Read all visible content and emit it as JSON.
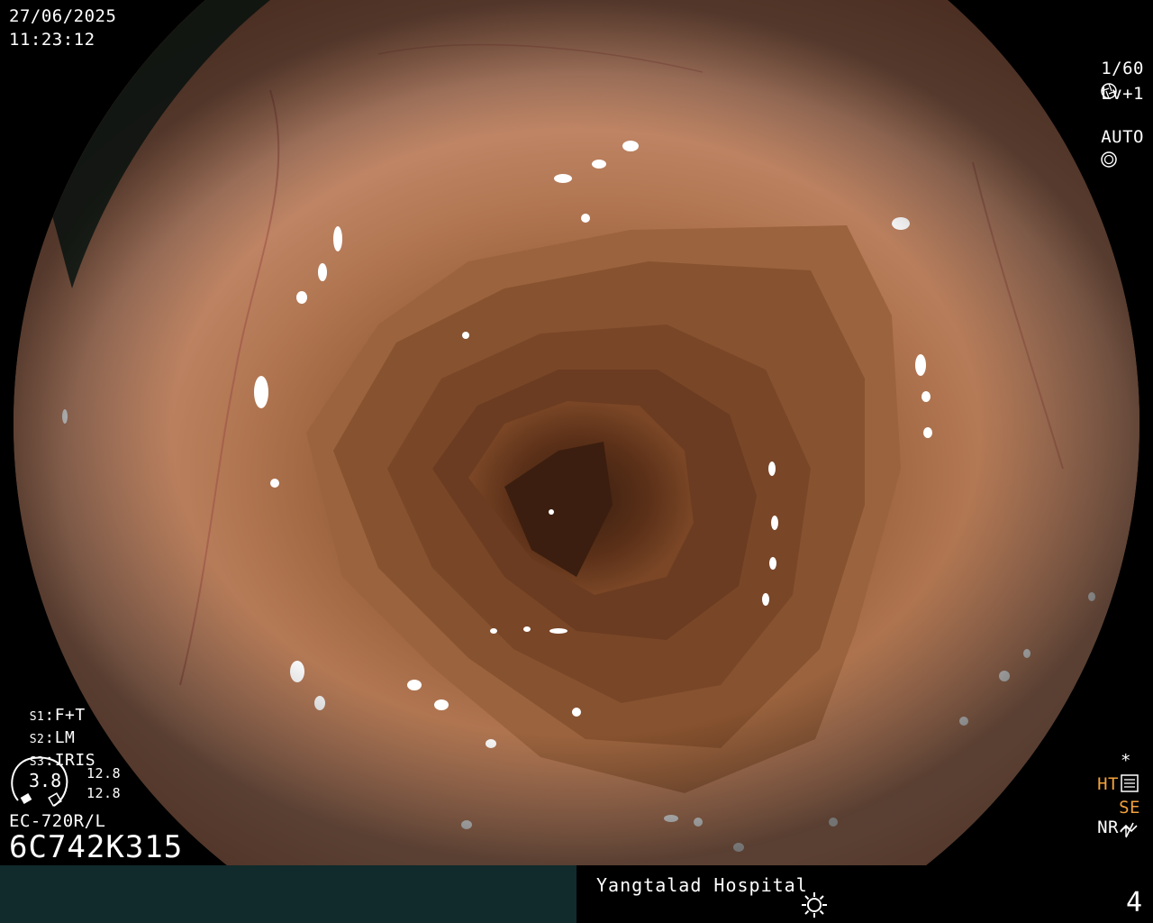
{
  "datetime": {
    "date": "27/06/2025",
    "time": "11:23:12"
  },
  "camera": {
    "shutter": "1/60",
    "level": "Lv+1",
    "mode": "AUTO"
  },
  "settings": [
    {
      "key": "S1",
      "value": "F+T"
    },
    {
      "key": "S2",
      "value": "LM"
    },
    {
      "key": "S3",
      "value": "IRIS"
    }
  ],
  "gauge": {
    "center_value": "3.8",
    "upper": "12.8",
    "lower": "12.8"
  },
  "scope": {
    "model": "EC-720R/L",
    "serial": "6C742K315"
  },
  "status_right": {
    "ht": "HT",
    "nr": "NR",
    "se": "SE"
  },
  "footer": {
    "hospital": "Yangtalad Hospital",
    "frame_number": "4"
  },
  "icons": [
    "shutter-icon",
    "auto-iris-icon",
    "star-icon",
    "settings-panel-icon",
    "enhance-icon",
    "structure-icon",
    "light-sun-icon"
  ],
  "colors": {
    "bar_left": "#112a2b",
    "tissue_base": "#b97b5a",
    "status_orange": "#f3a23a"
  }
}
